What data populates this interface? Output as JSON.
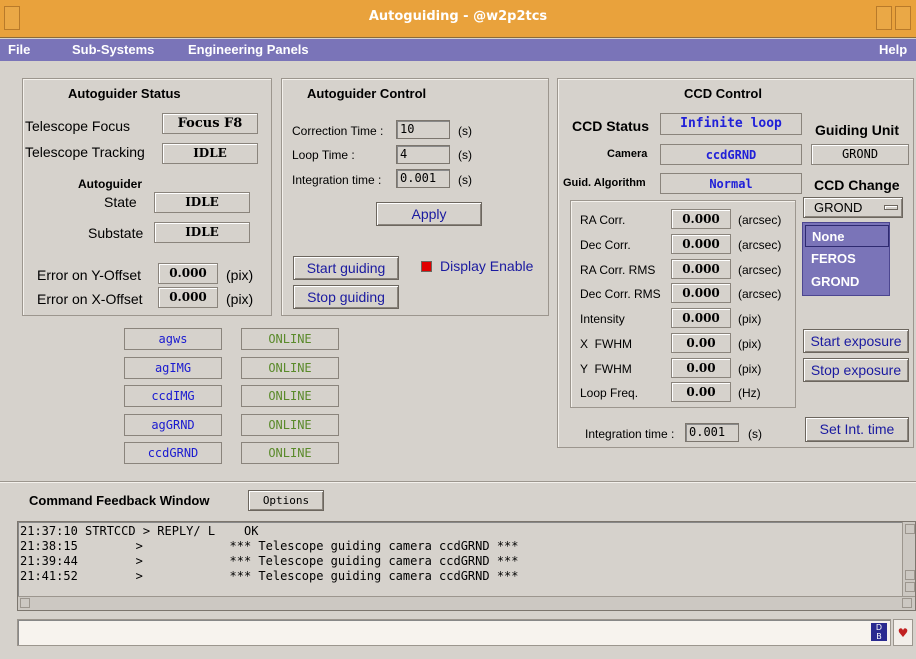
{
  "window": {
    "title": "Autoguiding - @w2p2tcs"
  },
  "menubar": {
    "file": "File",
    "subsystems": "Sub-Systems",
    "engineering": "Engineering Panels",
    "help": "Help"
  },
  "ag_status": {
    "header": "Autoguider Status",
    "telescope_focus_label": "Telescope Focus",
    "telescope_focus_value": "Focus F8",
    "telescope_tracking_label": "Telescope Tracking",
    "telescope_tracking_value": "IDLE",
    "autoguider_label": "Autoguider",
    "state_label": "State",
    "state_value": "IDLE",
    "substate_label": "Substate",
    "substate_value": "IDLE",
    "err_y_label": "Error on Y-Offset",
    "err_y_value": "0.000",
    "err_x_label": "Error on X-Offset",
    "err_x_value": "0.000",
    "unit_pix": "(pix)"
  },
  "ag_control": {
    "header": "Autoguider Control",
    "correction_label": "Correction Time :",
    "correction_value": "10",
    "loop_label": "Loop Time :",
    "loop_value": "4",
    "integration_label": "Integration time :",
    "integration_value": "0.001",
    "unit_s": "(s)",
    "apply": "Apply",
    "start_guiding": "Start guiding",
    "stop_guiding": "Stop guiding",
    "display_enable": "Display Enable",
    "display_enable_color": "#e00000"
  },
  "subsystems": [
    {
      "name": "agws",
      "status": "ONLINE"
    },
    {
      "name": "agIMG",
      "status": "ONLINE"
    },
    {
      "name": "ccdIMG",
      "status": "ONLINE"
    },
    {
      "name": "agGRND",
      "status": "ONLINE"
    },
    {
      "name": "ccdGRND",
      "status": "ONLINE"
    }
  ],
  "ccd": {
    "header": "CCD Control",
    "status_label": "CCD Status",
    "status_value": "Infinite loop",
    "camera_label": "Camera",
    "camera_value": "ccdGRND",
    "algo_label": "Guid. Algorithm",
    "algo_value": "Normal",
    "guiding_unit_label": "Guiding Unit",
    "guiding_unit_value": "GROND",
    "ccd_change_label": "CCD Change",
    "ccd_change_value": "GROND",
    "dropdown_options": [
      "None",
      "FEROS",
      "GROND"
    ],
    "measurements": [
      {
        "label": "RA Corr.",
        "value": "0.000",
        "unit": "(arcsec)"
      },
      {
        "label": "Dec Corr.",
        "value": "0.000",
        "unit": "(arcsec)"
      },
      {
        "label": "RA Corr. RMS",
        "value": "0.000",
        "unit": "(arcsec)"
      },
      {
        "label": "Dec Corr. RMS",
        "value": "0.000",
        "unit": "(arcsec)"
      },
      {
        "label": "Intensity",
        "value": "0.000",
        "unit": "(pix)"
      },
      {
        "label": "X  FWHM",
        "value": "0.00",
        "unit": "(pix)"
      },
      {
        "label": "Y  FWHM",
        "value": "0.00",
        "unit": "(pix)"
      },
      {
        "label": "Loop Freq.",
        "value": "0.00",
        "unit": "(Hz)"
      }
    ],
    "start_exposure": "Start exposure",
    "stop_exposure": "Stop exposure",
    "set_int_time": "Set Int. time",
    "int_label": "Integration time :",
    "int_value": "0.001",
    "int_unit": "(s)"
  },
  "feedback": {
    "title": "Command Feedback Window",
    "options": "Options",
    "lines": [
      "21:37:10 STRTCCD > REPLY/ L    OK",
      "21:38:15        >            *** Telescope guiding camera ccdGRND ***",
      "21:39:44        >            *** Telescope guiding camera ccdGRND ***",
      "21:41:52        >            *** Telescope guiding camera ccdGRND ***"
    ]
  },
  "colors": {
    "titlebar": "#e9a23c",
    "menubar": "#7a74b8",
    "dropdown": "#7a74b8",
    "accent_blue": "#2020d8",
    "online_green": "#5a8a2a"
  }
}
